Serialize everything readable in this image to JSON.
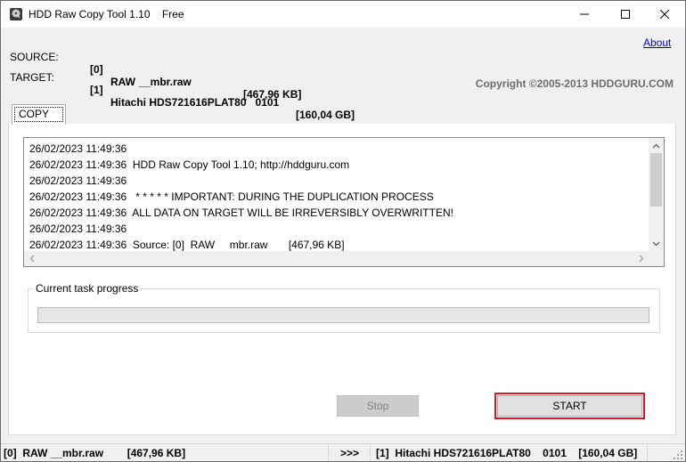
{
  "window": {
    "title": "HDD Raw Copy Tool 1.10    Free"
  },
  "source": {
    "label": "SOURCE:",
    "index": "[0]",
    "name": "RAW __mbr.raw",
    "size": "[467,96 KB]"
  },
  "target": {
    "label": "TARGET:",
    "index": "[1]",
    "name": "Hitachi HDS721616PLAT80   0101",
    "size": "[160,04 GB]"
  },
  "about_label": "About",
  "copyright": "Copyright ©2005-2013 HDDGURU.COM",
  "tabs": [
    {
      "label": "COPY",
      "active": true
    }
  ],
  "log": [
    "26/02/2023 11:49:36",
    "26/02/2023 11:49:36  HDD Raw Copy Tool 1.10; http://hddguru.com",
    "26/02/2023 11:49:36",
    "26/02/2023 11:49:36   * * * * * IMPORTANT: DURING THE DUPLICATION PROCESS",
    "26/02/2023 11:49:36  ALL DATA ON TARGET WILL BE IRREVERSIBLY OVERWRITTEN!",
    "26/02/2023 11:49:36",
    "26/02/2023 11:49:36  Source: [0]  RAW     mbr.raw       [467,96 KB]"
  ],
  "progress": {
    "label": "Current task progress",
    "value_percent": 0
  },
  "buttons": {
    "stop_label": "Stop",
    "start_label": "START"
  },
  "status": {
    "left": "[0]  RAW __mbr.raw        [467,96 KB]",
    "mid": ">>>",
    "right": "[1]  Hitachi HDS721616PLAT80    0101    [160,04 GB]"
  },
  "colors": {
    "highlight_border": "#e0141e",
    "link": "#0000ee",
    "copyright_text": "#6d6d6d"
  }
}
